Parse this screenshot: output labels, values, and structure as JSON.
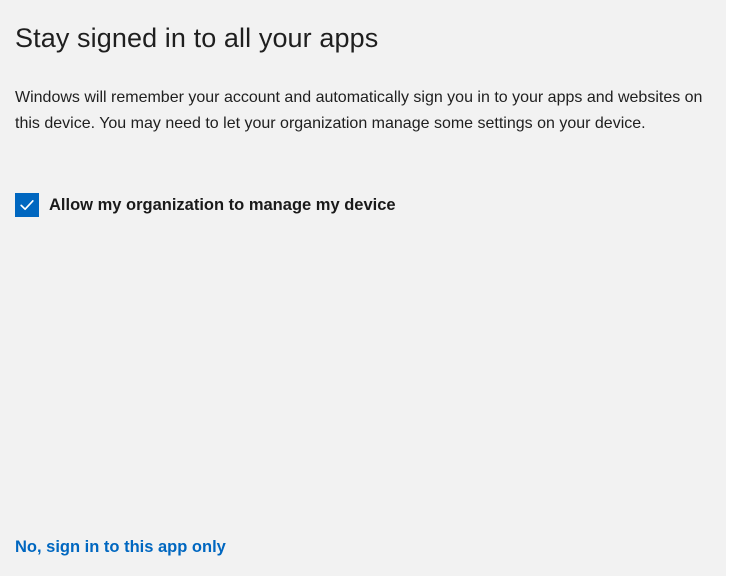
{
  "dialog": {
    "title": "Stay signed in to all your apps",
    "description": "Windows will remember your account and automatically sign you in to your apps and websites on this device. You may need to let your organization manage some settings on your device.",
    "checkbox": {
      "label": "Allow my organization to manage my device",
      "checked": true,
      "icon": "checkmark-icon"
    },
    "secondary_link": "No, sign in to this app only"
  },
  "colors": {
    "background": "#f2f2f2",
    "accent": "#0067c0",
    "text": "#1a1a1a"
  }
}
